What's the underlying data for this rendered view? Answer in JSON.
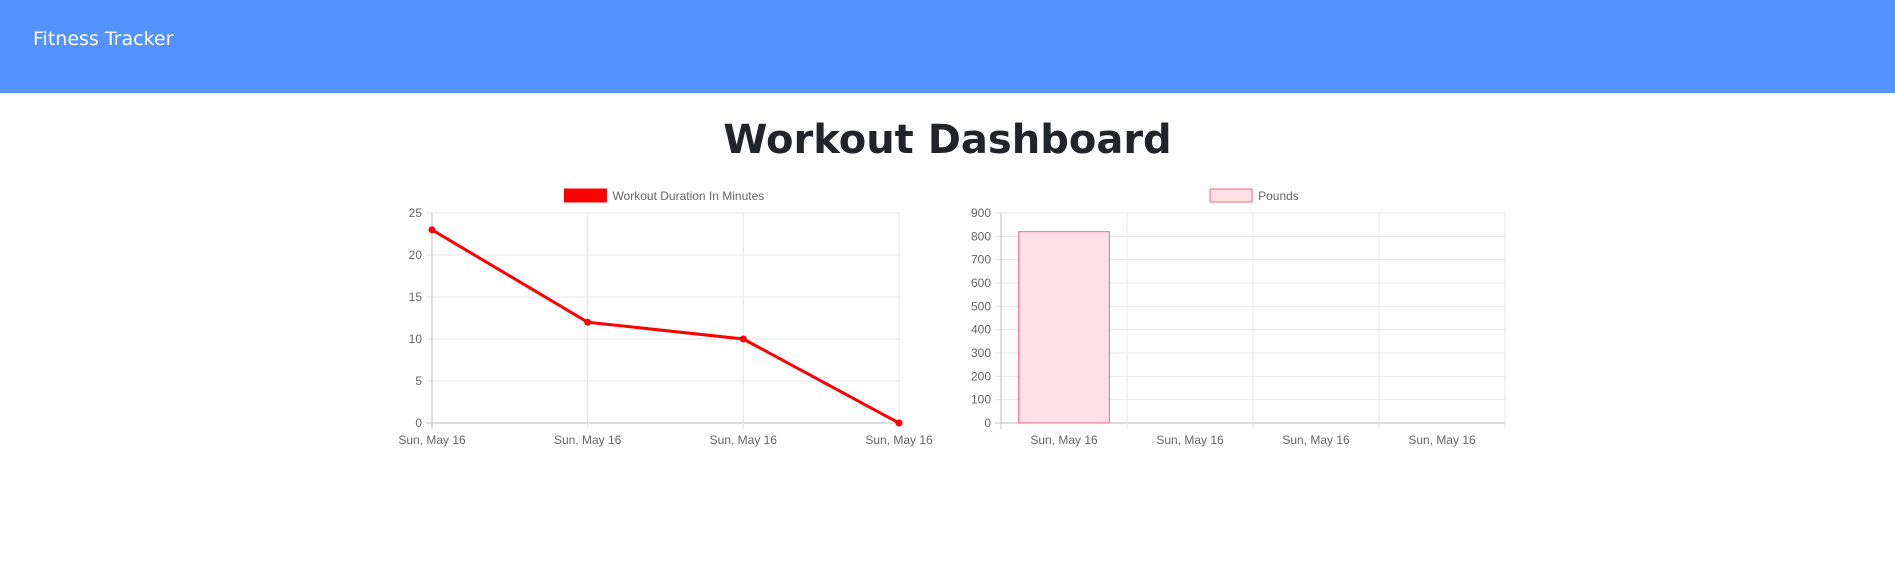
{
  "navbar": {
    "brand": "Fitness Tracker"
  },
  "page": {
    "title": "Workout Dashboard"
  },
  "chart_data": [
    {
      "type": "line",
      "categories": [
        "Sun, May 16",
        "Sun, May 16",
        "Sun, May 16",
        "Sun, May 16"
      ],
      "series": [
        {
          "name": "Workout Duration In Minutes",
          "values": [
            23,
            12,
            10,
            0
          ],
          "color": "#ff0000"
        }
      ],
      "ylim": [
        0,
        25
      ],
      "yticks": [
        0,
        5,
        10,
        15,
        20,
        25
      ],
      "grid": true,
      "legend": "top"
    },
    {
      "type": "bar",
      "categories": [
        "Sun, May 16",
        "Sun, May 16",
        "Sun, May 16",
        "Sun, May 16"
      ],
      "series": [
        {
          "name": "Pounds",
          "values": [
            820,
            0,
            0,
            0
          ],
          "color": "#ff6384",
          "fill": "#ffe0e6"
        }
      ],
      "ylim": [
        0,
        900
      ],
      "yticks": [
        0,
        100,
        200,
        300,
        400,
        500,
        600,
        700,
        800,
        900
      ],
      "grid": true,
      "legend": "top"
    }
  ]
}
